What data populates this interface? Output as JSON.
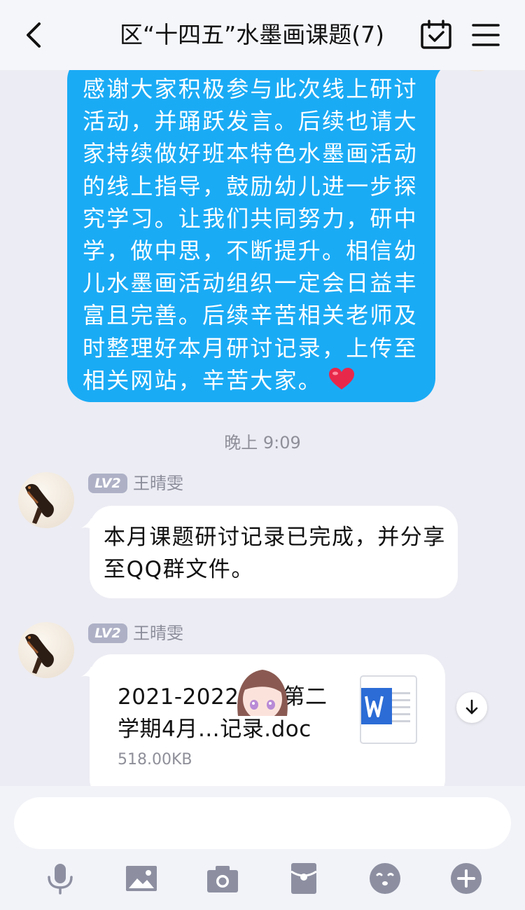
{
  "header": {
    "title": "区“十四五”水墨画课题(7)",
    "back_icon": "chevron-left-icon",
    "calendar_icon": "calendar-check-icon",
    "menu_icon": "hamburger-menu-icon"
  },
  "messages": {
    "self_message": {
      "text": "感谢大家积极参与此次线上研讨活动，并踊跃发言。后续也请大家持续做好班本特色水墨画活动的线上指导，鼓励幼儿进一步探究学习。让我们共同努力，研中学，做中思，不断提升。相信幼儿水墨画活动组织一定会日益丰富且完善。后续辛苦相关老师及时整理好本月研讨记录，上传至相关网站，辛苦大家。",
      "emoji": "heart-icon"
    },
    "timestamp": "晚上 9:09",
    "msg1": {
      "level": "LV2",
      "sender": "王晴雯",
      "text": "本月课题研讨记录已完成，并分享至QQ群文件。"
    },
    "msg2": {
      "level": "LV2",
      "sender": "王晴雯",
      "file_name": "2021-2022学年第二学期4月…记录.doc",
      "file_size": "518.00KB",
      "file_icon": "word-document-icon"
    }
  },
  "input": {
    "value": "",
    "placeholder": ""
  },
  "toolbar": {
    "icons": [
      "microphone-icon",
      "image-icon",
      "camera-icon",
      "red-packet-icon",
      "emoji-icon",
      "plus-icon"
    ]
  },
  "colors": {
    "self_bubble": "#1aabf5",
    "other_bubble": "#ffffff",
    "background": "#ececf4",
    "level_badge": "#aeb1c6"
  }
}
